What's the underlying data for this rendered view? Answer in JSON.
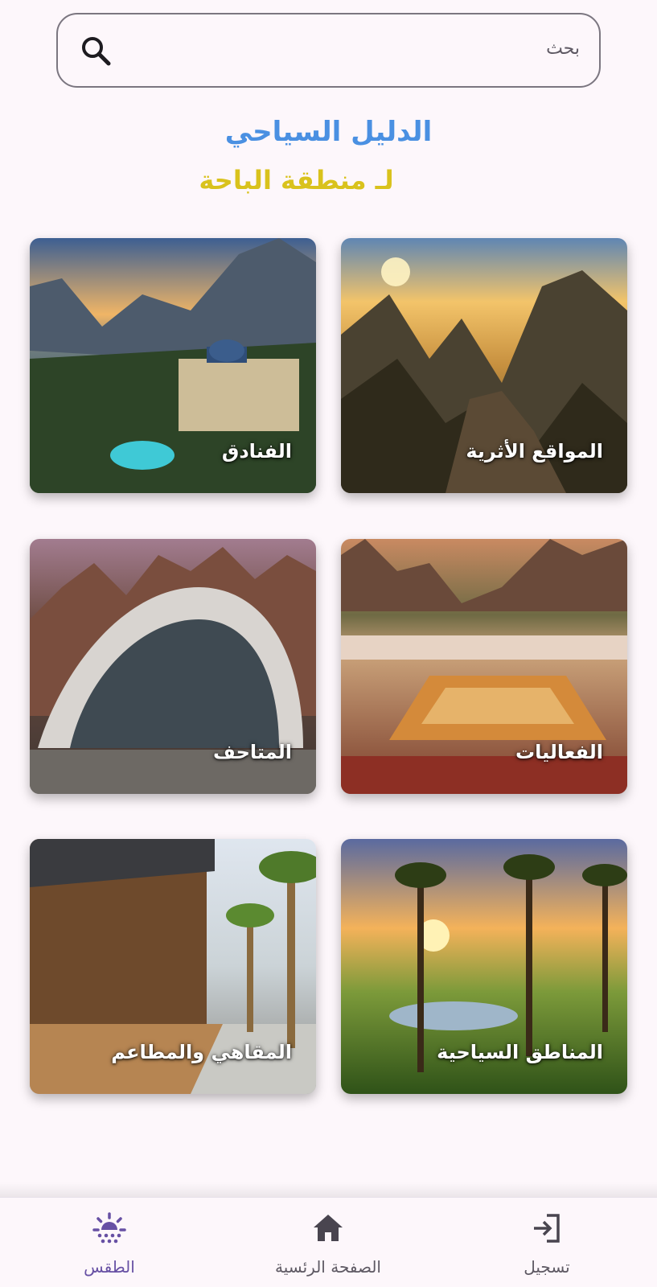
{
  "search": {
    "placeholder": "بحث"
  },
  "header": {
    "title": "الدليل السياحي",
    "subtitle": "لـ منطقة الباحة"
  },
  "cards": [
    {
      "label": "المواقع الأثرية",
      "icon": "mountain-sunrise-image"
    },
    {
      "label": "الفنادق",
      "icon": "hotel-valley-image"
    },
    {
      "label": "الفعاليات",
      "icon": "festival-crowd-image"
    },
    {
      "label": "المتاحف",
      "icon": "museum-building-image"
    },
    {
      "label": "المناطق السياحية",
      "icon": "palm-oasis-image"
    },
    {
      "label": "المقاهي والمطاعم",
      "icon": "cafe-terrace-image"
    }
  ],
  "bottom_nav": {
    "login": {
      "label": "تسجيل",
      "icon": "login-icon"
    },
    "home": {
      "label": "الصفحة الرئسية",
      "icon": "home-icon"
    },
    "weather": {
      "label": "الطقس",
      "icon": "sun-icon"
    }
  },
  "colors": {
    "title": "#4a90e2",
    "subtitle": "#d9c21c",
    "active_nav": "#6750a4"
  }
}
